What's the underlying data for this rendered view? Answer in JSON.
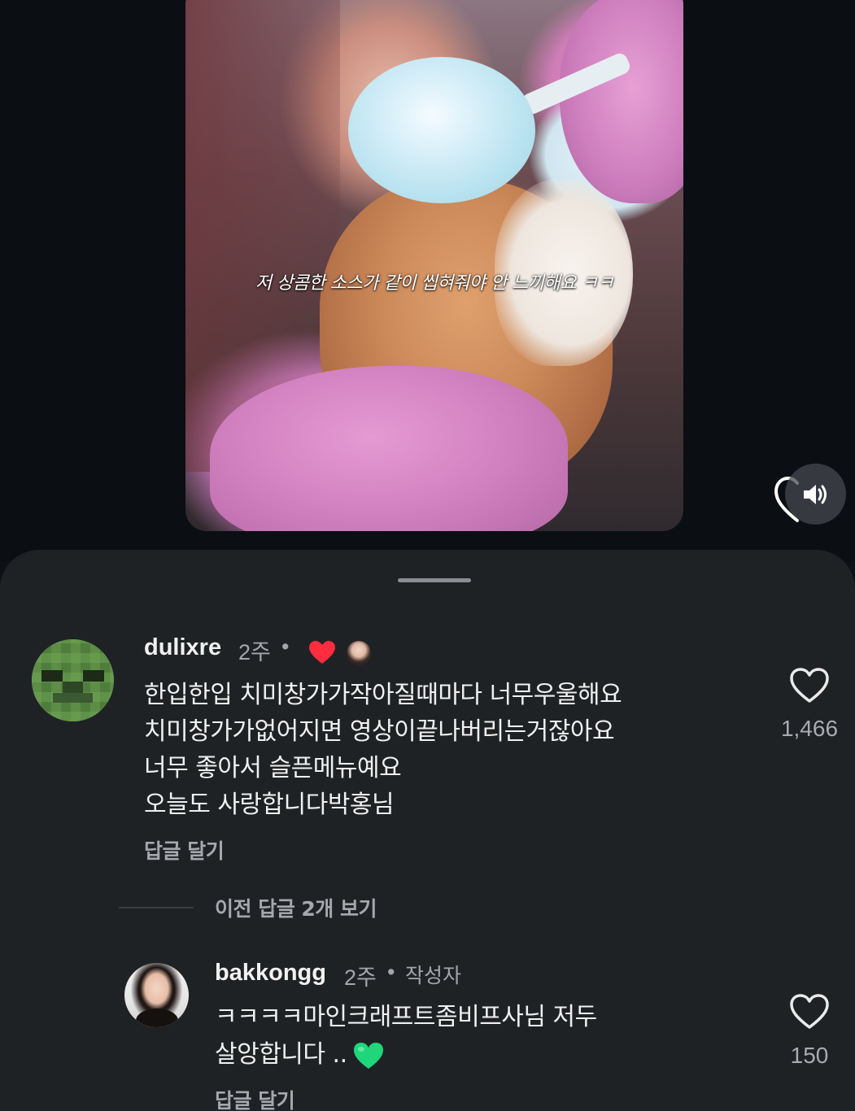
{
  "video": {
    "caption": "저 상콤한 소스가 같이 씹혀줘야 안 느끼해요 ㅋㅋ"
  },
  "colors": {
    "sheet_background": "#1f2225",
    "heart_red": "#ff2d3d",
    "heart_green": "#1fd67b",
    "muted_text": "#a5a8ac"
  },
  "icons": {
    "volume": "volume-icon",
    "like": "heart-outline-icon",
    "creator_liked": "red-heart-icon",
    "emoji": "green-heart-emoji"
  },
  "comments": [
    {
      "username": "dulixre",
      "time": "2주",
      "separator": "•",
      "lines": [
        "한입한입 치미창가가작아질때마다 너무우울해요",
        "치미창가가없어지면 영상이끝나버리는거잖아요",
        "너무 좋아서 슬픈메뉴예요",
        "오늘도 사랑합니다박홍님"
      ],
      "reply_label": "답글 달기",
      "likes": "1,466"
    }
  ],
  "view_previous_replies": "이전 답글 2개 보기",
  "reply": {
    "username": "bakkongg",
    "time": "2주",
    "separator": "•",
    "author_badge": "작성자",
    "line1": "ㅋㅋㅋㅋ마인크래프트좀비프사님 저두",
    "line2": "살앙합니다 ..",
    "reply_label": "답글 달기",
    "likes": "150"
  }
}
